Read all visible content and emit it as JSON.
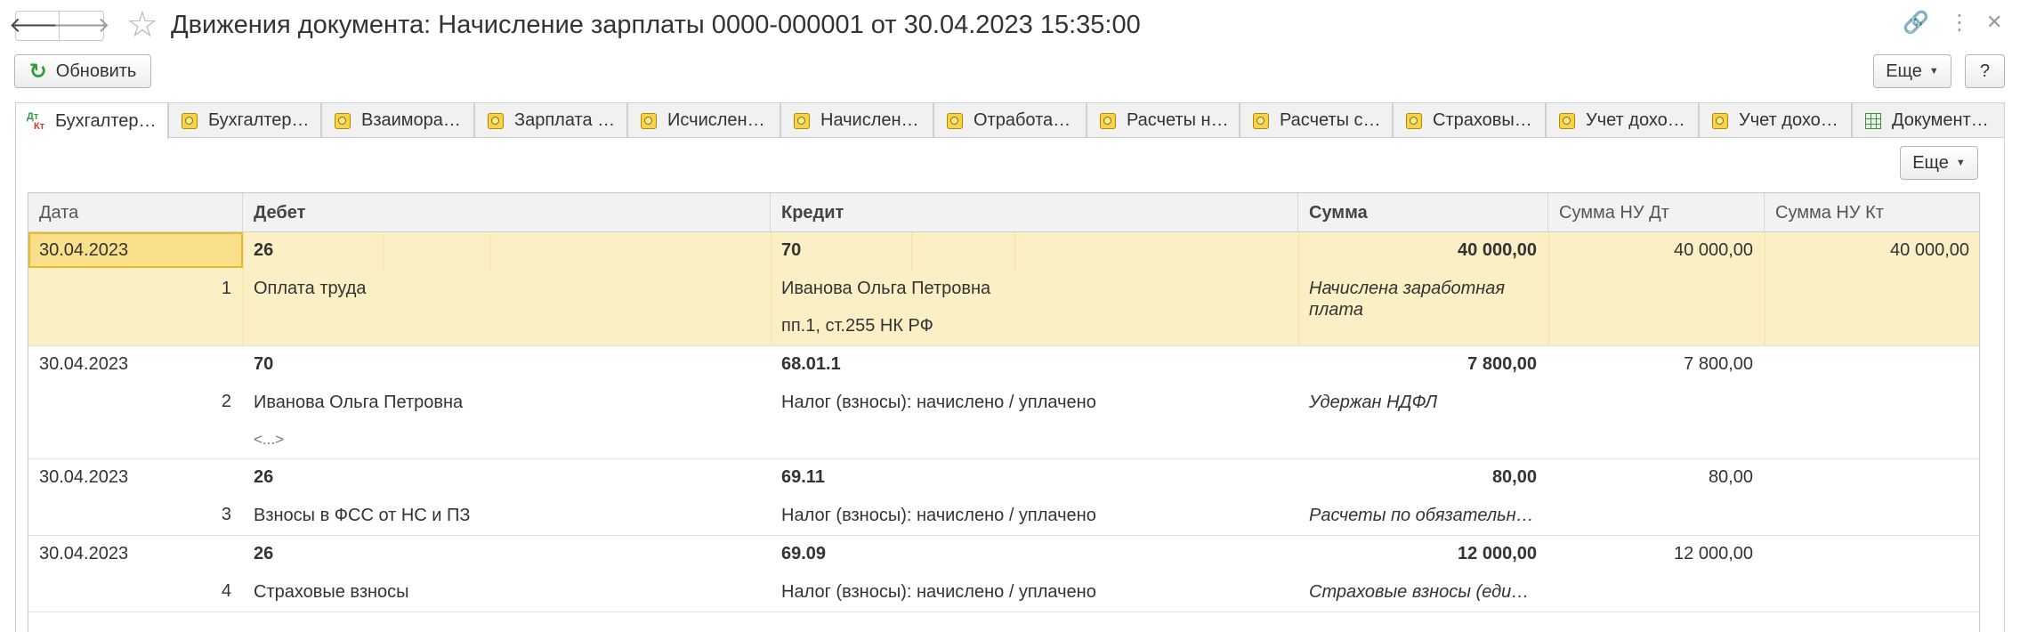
{
  "window": {
    "title": "Движения документа: Начисление зарплаты 0000-000001 от 30.04.2023 15:35:00",
    "icons": [
      "back-arrow-icon",
      "forward-arrow-icon",
      "star-icon",
      "link-icon",
      "more-vertical-icon",
      "close-icon"
    ]
  },
  "toolbar": {
    "refresh_label": "Обновить",
    "more_label": "Еще",
    "help_label": "?",
    "grid_more_label": "Еще"
  },
  "tabs": [
    {
      "label": "Бухгалтер…",
      "icon": "dt-kt-icon",
      "active": true
    },
    {
      "label": "Бухгалтер…",
      "icon": "register-icon"
    },
    {
      "label": "Взаимора…",
      "icon": "register-icon"
    },
    {
      "label": "Зарплата …",
      "icon": "register-icon"
    },
    {
      "label": "Исчислен…",
      "icon": "register-icon"
    },
    {
      "label": "Начислен…",
      "icon": "register-icon"
    },
    {
      "label": "Отработа…",
      "icon": "register-icon"
    },
    {
      "label": "Расчеты н…",
      "icon": "register-icon"
    },
    {
      "label": "Расчеты с…",
      "icon": "register-icon"
    },
    {
      "label": "Страховы…",
      "icon": "register-icon"
    },
    {
      "label": "Учет дохо…",
      "icon": "register-icon"
    },
    {
      "label": "Учет дохо…",
      "icon": "register-icon"
    },
    {
      "label": "Документ…",
      "icon": "table-icon"
    }
  ],
  "grid": {
    "columns": [
      "Дата",
      "Дебет",
      "Кредит",
      "Сумма",
      "Сумма НУ Дт",
      "Сумма НУ Кт"
    ],
    "rows": [
      {
        "date": "30.04.2023",
        "num": "1",
        "debit": "26",
        "debit_sub": [
          "Оплата труда"
        ],
        "credit": "70",
        "credit_sub": [
          "Иванова Ольга Петровна",
          "пп.1, ст.255 НК РФ"
        ],
        "sum": "40 000,00",
        "content": "Начислена заработная плата",
        "nu_dt": "40 000,00",
        "nu_kt": "40 000,00",
        "selected": true
      },
      {
        "date": "30.04.2023",
        "num": "2",
        "debit": "70",
        "debit_sub": [
          "Иванова Ольга Петровна",
          "<...>"
        ],
        "credit": "68.01.1",
        "credit_sub": [
          "Налог (взносы): начислено / уплачено"
        ],
        "sum": "7 800,00",
        "content": "Удержан НДФЛ",
        "nu_dt": "7 800,00",
        "nu_kt": ""
      },
      {
        "date": "30.04.2023",
        "num": "3",
        "debit": "26",
        "debit_sub": [
          "Взносы в ФСС от НС и ПЗ"
        ],
        "credit": "69.11",
        "credit_sub": [
          "Налог (взносы): начислено / уплачено"
        ],
        "sum": "80,00",
        "content": "Расчеты по обязательн…",
        "nu_dt": "80,00",
        "nu_kt": ""
      },
      {
        "date": "30.04.2023",
        "num": "4",
        "debit": "26",
        "debit_sub": [
          "Страховые взносы"
        ],
        "credit": "69.09",
        "credit_sub": [
          "Налог (взносы): начислено / уплачено"
        ],
        "sum": "12 000,00",
        "content": "Страховые взносы (еди…",
        "nu_dt": "12 000,00",
        "nu_kt": ""
      }
    ]
  },
  "colors": {
    "selected_row": "#fbf0c5",
    "focus_cell_border": "#e8b92c",
    "refresh_icon": "#2e9d3a"
  }
}
